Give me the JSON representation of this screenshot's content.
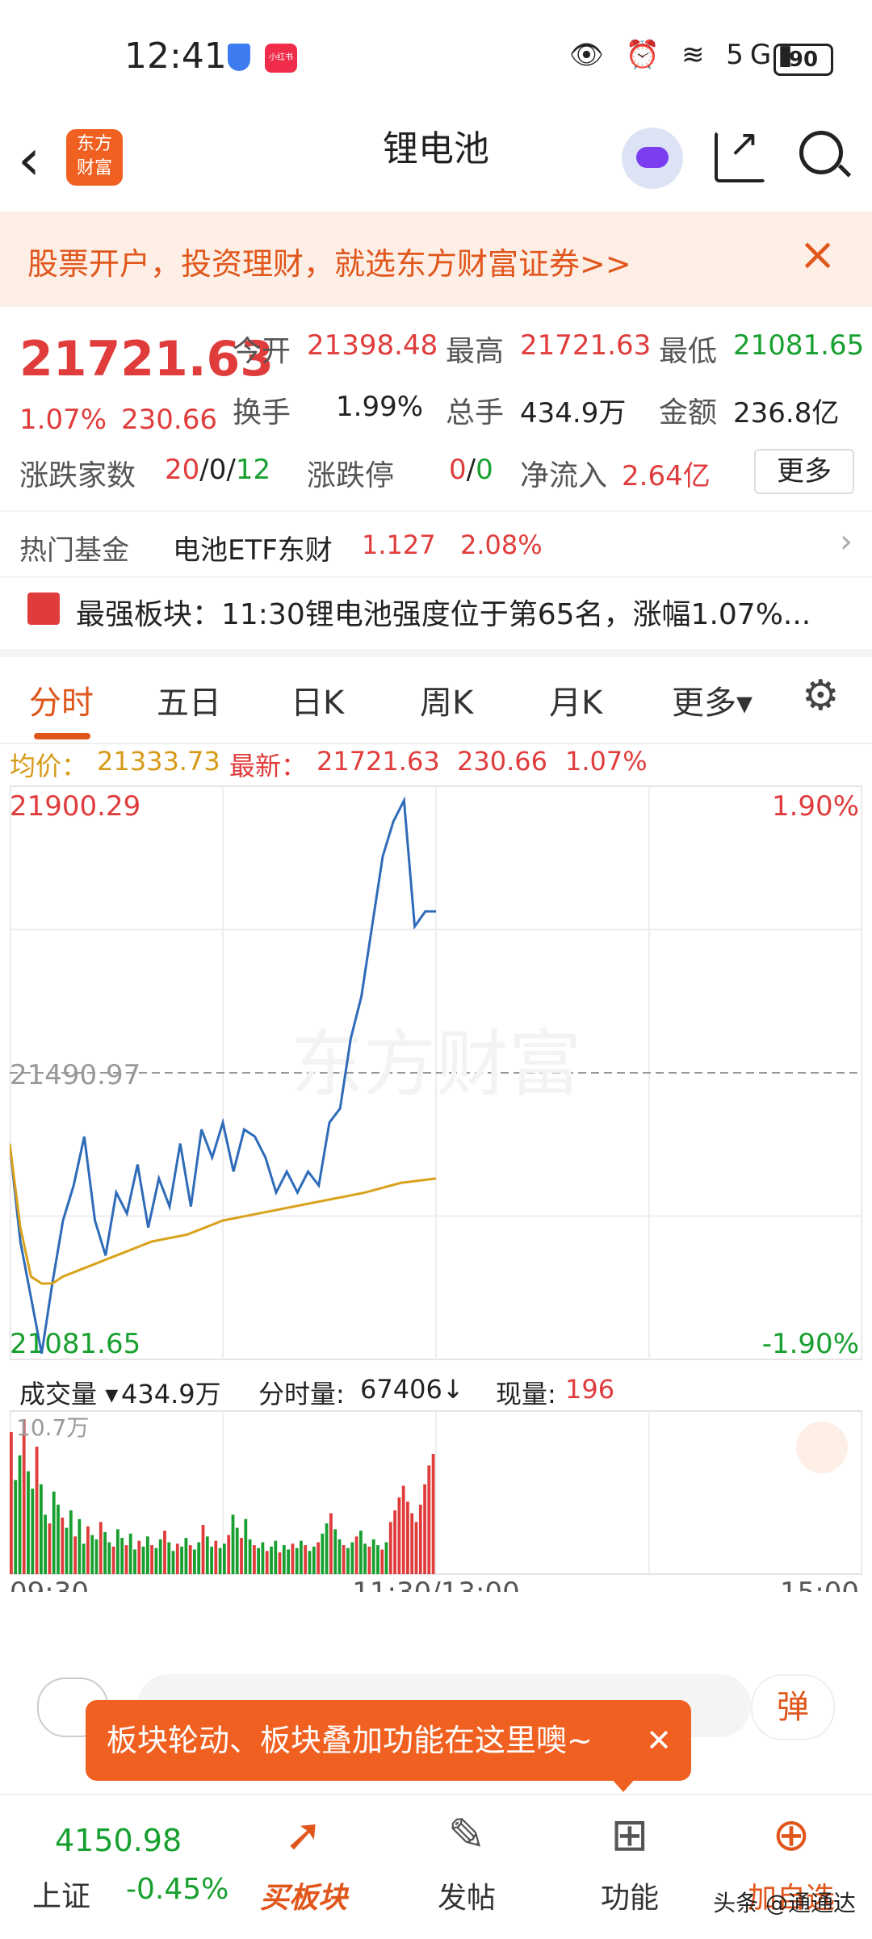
{
  "status_bar": {
    "time": "12:41",
    "network": "5G",
    "battery": "90",
    "xhs_label": "小红书"
  },
  "header": {
    "title": "锂电池",
    "logo_line1": "东方",
    "logo_line2": "财富"
  },
  "banner": {
    "text": "股票开户，投资理财，就选东方财富证券>>",
    "close": "×"
  },
  "quote": {
    "price": "21721.63",
    "change_pct": "1.07%",
    "change_amt": "230.66",
    "open_label": "今开",
    "open": "21398.48",
    "high_label": "最高",
    "high": "21721.63",
    "low_label": "最低",
    "low": "21081.65",
    "turnover_label": "换手",
    "turnover": "1.99%",
    "volume_label": "总手",
    "volume": "434.9万",
    "amount_label": "金额",
    "amount": "236.8亿",
    "advdec_label": "涨跌家数",
    "adv": "20",
    "flat": "0",
    "dec": "12",
    "sep": "/",
    "limit_label": "涨跌停",
    "limit_up": "0",
    "limit_down": "0",
    "netflow_label": "净流入",
    "netflow": "2.64亿",
    "more": "更多"
  },
  "hot_fund": {
    "label": "热门基金",
    "name": "电池ETF东财",
    "price": "1.127",
    "pct": "2.08%"
  },
  "strongest": {
    "text": "最强板块：11:30锂电池强度位于第65名，涨幅1.07%..."
  },
  "tabs": [
    "分时",
    "五日",
    "日K",
    "周K",
    "月K",
    "更多▾"
  ],
  "avg_row": {
    "avg_label": "均价：",
    "avg": "21333.73",
    "latest_label": "最新：",
    "latest": "21721.63",
    "chg": "230.66",
    "pct": "1.07%"
  },
  "chart_axis": {
    "y_top": "21900.29",
    "y_mid": "21490.97",
    "y_bottom": "21081.65",
    "pct_top": "1.90%",
    "pct_bottom": "-1.90%",
    "vol_max": "10.7万",
    "x_labels": [
      "09:30",
      "11:30/13:00",
      "15:00"
    ],
    "watermark": "东方财富"
  },
  "volume_row": {
    "label": "成交量",
    "value": "434.9万",
    "minute_label": "分时量:",
    "minute_value": "67406↓",
    "now_label": "现量:",
    "now_value": "196"
  },
  "input_bar": {
    "danmu": "弹"
  },
  "toast": {
    "text": "板块轮动、板块叠加功能在这里噢~",
    "close": "✕"
  },
  "bottom_nav": {
    "index_value": "4150.98",
    "index_name": "上证",
    "index_pct": "-0.45%",
    "items": [
      "买板块",
      "发帖",
      "功能",
      "加自选"
    ]
  },
  "footer_watermark": "头条 @通通达",
  "chart_data": {
    "type": "line",
    "ylim": [
      21081.65,
      21900.29
    ],
    "reference": 21490.97,
    "series": [
      {
        "name": "最新",
        "x_index": [
          0,
          3,
          6,
          9,
          12,
          15,
          18,
          21,
          24,
          27,
          30,
          33,
          36,
          39,
          42,
          45,
          48,
          51,
          54,
          57,
          60,
          63,
          66,
          69,
          72,
          75,
          78,
          81,
          84,
          87,
          90,
          93,
          96,
          99,
          102,
          105,
          108,
          111,
          114,
          117,
          120
        ],
        "values": [
          21390,
          21250,
          21170,
          21090,
          21190,
          21280,
          21330,
          21400,
          21280,
          21230,
          21320,
          21290,
          21360,
          21270,
          21340,
          21300,
          21390,
          21300,
          21410,
          21370,
          21420,
          21350,
          21410,
          21400,
          21370,
          21320,
          21350,
          21320,
          21350,
          21330,
          21420,
          21440,
          21540,
          21600,
          21700,
          21800,
          21850,
          21880,
          21700,
          21721.63,
          21721.63
        ]
      },
      {
        "name": "均价",
        "x_index": [
          0,
          3,
          6,
          9,
          12,
          15,
          20,
          30,
          40,
          50,
          60,
          70,
          80,
          90,
          100,
          110,
          120
        ],
        "values": [
          21390,
          21270,
          21200,
          21190,
          21190,
          21200,
          21210,
          21230,
          21250,
          21260,
          21280,
          21290,
          21300,
          21310,
          21320,
          21333.73,
          21340
        ]
      }
    ],
    "volume": [
      9.8,
      6.5,
      8.2,
      10.7,
      7.1,
      5.9,
      8.8,
      6.2,
      4.1,
      3.5,
      5.7,
      4.8,
      3.9,
      3.2,
      4.4,
      2.6,
      3.8,
      2.1,
      3.3,
      2.7,
      2.4,
      3.6,
      2.9,
      2.2,
      1.9,
      3.1,
      2.5,
      2.0,
      2.8,
      1.7,
      2.3,
      1.9,
      2.6,
      2.0,
      1.8,
      2.4,
      3.0,
      2.2,
      1.6,
      2.1,
      1.9,
      2.5,
      2.0,
      1.7,
      2.2,
      3.4,
      2.6,
      1.9,
      2.3,
      1.8,
      2.1,
      2.7,
      4.1,
      3.2,
      2.5,
      3.8,
      2.4,
      2.0,
      1.8,
      2.2,
      1.6,
      1.9,
      2.3,
      1.5,
      2.0,
      1.7,
      2.1,
      1.8,
      2.3,
      2.0,
      1.6,
      1.9,
      2.2,
      2.8,
      3.5,
      4.2,
      3.1,
      2.4,
      2.0,
      1.8,
      2.2,
      2.6,
      3.0,
      2.1,
      1.9,
      2.4,
      2.0,
      1.7,
      2.2,
      3.6,
      4.4,
      5.3,
      6.1,
      5.0,
      4.2,
      3.6,
      4.8,
      6.2,
      7.5,
      8.3
    ],
    "volume_colors_up_every": [
      0,
      2,
      3,
      5,
      7,
      9
    ]
  }
}
